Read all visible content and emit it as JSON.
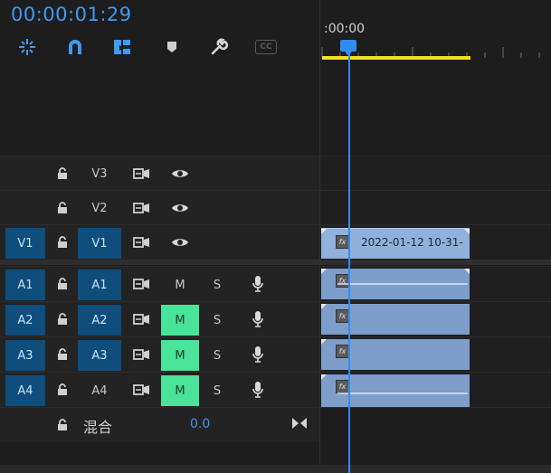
{
  "timecode": "00:00:01:29",
  "ruler": {
    "time_label": ":00:00"
  },
  "toolbar": [
    {
      "name": "snap-icon"
    },
    {
      "name": "linked-selection-icon"
    },
    {
      "name": "insert-overwrite-icon"
    },
    {
      "name": "add-marker-icon"
    },
    {
      "name": "wrench-icon"
    },
    {
      "name": "captions-icon",
      "label": "CC"
    }
  ],
  "video_tracks": [
    {
      "target": "V3",
      "source": ""
    },
    {
      "target": "V2",
      "source": ""
    },
    {
      "target": "V1",
      "source": "V1"
    }
  ],
  "audio_tracks": [
    {
      "target": "A1",
      "source": "A1",
      "mute": "M",
      "solo": "S",
      "muted": false
    },
    {
      "target": "A2",
      "source": "A2",
      "mute": "M",
      "solo": "S",
      "muted": true
    },
    {
      "target": "A3",
      "source": "A3",
      "mute": "M",
      "solo": "S",
      "muted": true
    },
    {
      "target": "A4",
      "source": "A4",
      "mute": "M",
      "solo": "S",
      "muted": true
    }
  ],
  "clip": {
    "name": "2022-01-12 10-31-",
    "fx": "fx"
  },
  "mix": {
    "label": "混合",
    "value": "0.0"
  },
  "colors": {
    "accent": "#3f9af2",
    "track_target": "#0e4d7c",
    "mute_on": "#4ae39a",
    "work_area": "#f0e41c",
    "clip": "#8fb1dc"
  }
}
